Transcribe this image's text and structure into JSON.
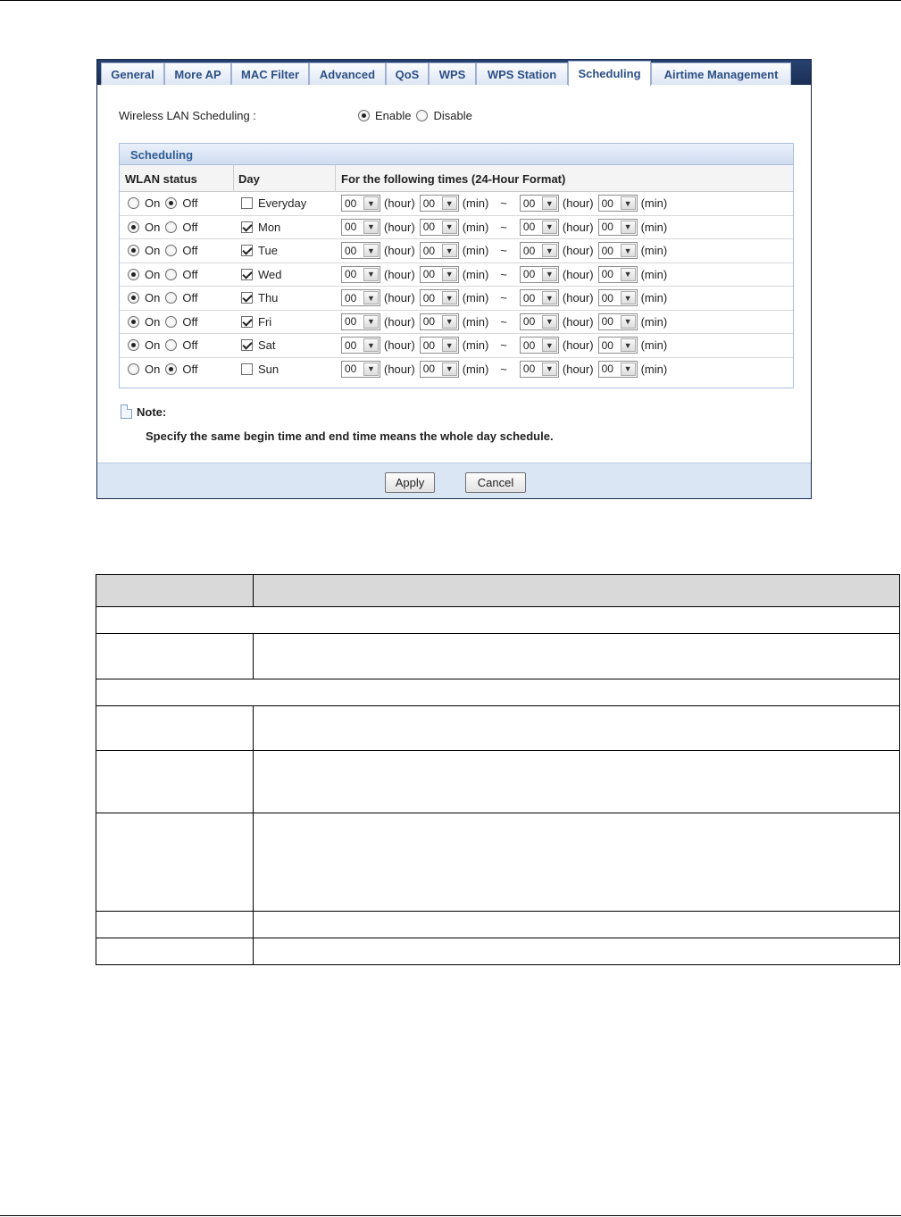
{
  "tabs": [
    {
      "label": "General",
      "active": false
    },
    {
      "label": "More AP",
      "active": false
    },
    {
      "label": "MAC Filter",
      "active": false
    },
    {
      "label": "Advanced",
      "active": false
    },
    {
      "label": "QoS",
      "active": false
    },
    {
      "label": "WPS",
      "active": false
    },
    {
      "label": "WPS Station",
      "active": false
    },
    {
      "label": "Scheduling",
      "active": true
    },
    {
      "label": "Airtime Management",
      "active": false
    }
  ],
  "wlan_scheduling": {
    "label": "Wireless LAN Scheduling :",
    "enable_label": "Enable",
    "disable_label": "Disable",
    "selected": "Enable"
  },
  "scheduling": {
    "title": "Scheduling",
    "headers": {
      "status": "WLAN status",
      "day": "Day",
      "times": "For the following times (24-Hour Format)"
    },
    "on_label": "On",
    "off_label": "Off",
    "hour_unit": "(hour)",
    "min_unit": "(min)",
    "tilde": "~",
    "rows": [
      {
        "day": "Everyday",
        "status": "Off",
        "checked": false,
        "start_hour": "00",
        "start_min": "00",
        "end_hour": "00",
        "end_min": "00"
      },
      {
        "day": "Mon",
        "status": "On",
        "checked": true,
        "start_hour": "00",
        "start_min": "00",
        "end_hour": "00",
        "end_min": "00"
      },
      {
        "day": "Tue",
        "status": "On",
        "checked": true,
        "start_hour": "00",
        "start_min": "00",
        "end_hour": "00",
        "end_min": "00"
      },
      {
        "day": "Wed",
        "status": "On",
        "checked": true,
        "start_hour": "00",
        "start_min": "00",
        "end_hour": "00",
        "end_min": "00"
      },
      {
        "day": "Thu",
        "status": "On",
        "checked": true,
        "start_hour": "00",
        "start_min": "00",
        "end_hour": "00",
        "end_min": "00"
      },
      {
        "day": "Fri",
        "status": "On",
        "checked": true,
        "start_hour": "00",
        "start_min": "00",
        "end_hour": "00",
        "end_min": "00"
      },
      {
        "day": "Sat",
        "status": "On",
        "checked": true,
        "start_hour": "00",
        "start_min": "00",
        "end_hour": "00",
        "end_min": "00"
      },
      {
        "day": "Sun",
        "status": "Off",
        "checked": false,
        "start_hour": "00",
        "start_min": "00",
        "end_hour": "00",
        "end_min": "00"
      }
    ]
  },
  "note": {
    "title": "Note:",
    "text": "Specify the same begin time and end time means the whole day schedule."
  },
  "buttons": {
    "apply": "Apply",
    "cancel": "Cancel"
  },
  "colors": {
    "tab_bar": "#1b2f55",
    "accent_text": "#2b4f86",
    "footer_bg": "#dbe6f5",
    "section_title": "#2f5b94"
  }
}
